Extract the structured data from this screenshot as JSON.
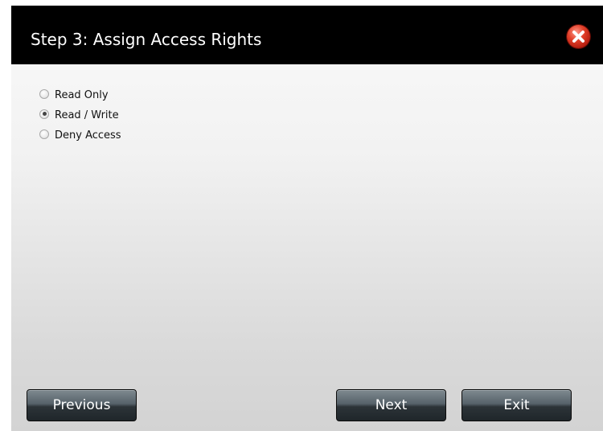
{
  "dialog": {
    "title": "Step 3: Assign Access Rights",
    "close_icon": "close-icon"
  },
  "access_options": [
    {
      "label": "Read Only",
      "checked": false
    },
    {
      "label": "Read / Write",
      "checked": true
    },
    {
      "label": "Deny Access",
      "checked": false
    }
  ],
  "buttons": {
    "previous": "Previous",
    "next": "Next",
    "exit": "Exit"
  },
  "colors": {
    "titlebar": "#000000",
    "close_button": "#d23a26",
    "button": "#3a444a"
  }
}
